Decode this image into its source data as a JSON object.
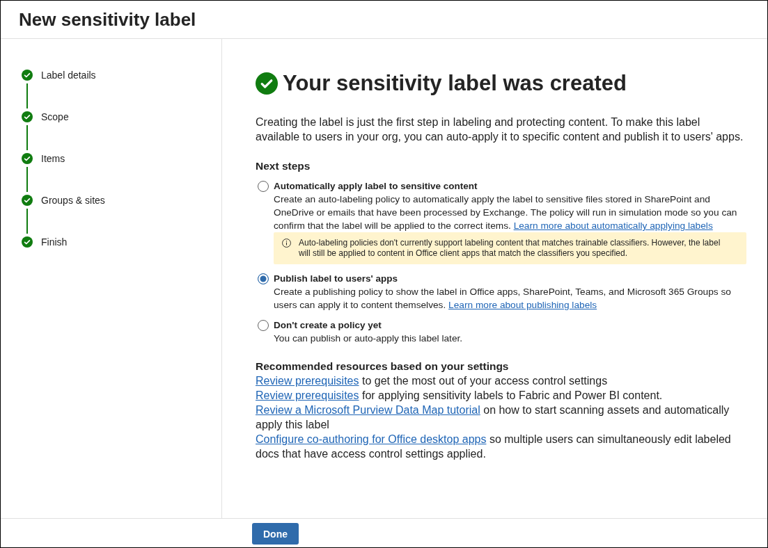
{
  "window": {
    "title": "New sensitivity label"
  },
  "steps": [
    {
      "label": "Label details",
      "completed": true
    },
    {
      "label": "Scope",
      "completed": true
    },
    {
      "label": "Items",
      "completed": true
    },
    {
      "label": "Groups & sites",
      "completed": true
    },
    {
      "label": "Finish",
      "completed": true
    }
  ],
  "confirmation": {
    "heading": "Your sensitivity label was created",
    "description": "Creating the label is just the first step in labeling and protecting content. To make this label available to users in your org, you can auto-apply it to specific content and publish it to users' apps."
  },
  "next_steps": {
    "heading": "Next steps",
    "options": [
      {
        "title": "Automatically apply label to sensitive content",
        "description": "Create an auto-labeling policy to automatically apply the label to sensitive files stored in SharePoint and OneDrive or emails that have been processed by Exchange. The policy will run in simulation mode so you can confirm that the label will be applied to the correct items.",
        "link": "Learn more about automatically applying labels",
        "notice": "Auto-labeling policies don't currently support labeling content that matches trainable classifiers. However, the label will still be applied to content in Office client apps that match the classifiers you specified.",
        "selected": false
      },
      {
        "title": "Publish label to users' apps",
        "description": "Create a publishing policy to show the label in Office apps, SharePoint, Teams, and Microsoft 365 Groups so users can apply it to content themselves.",
        "link": "Learn more about publishing labels",
        "selected": true
      },
      {
        "title": "Don't create a policy yet",
        "description": "You can publish or auto-apply this label later.",
        "selected": false
      }
    ]
  },
  "resources": {
    "heading": "Recommended resources based on your settings",
    "items": [
      {
        "link": "Review prerequisites",
        "text": "to get the most out of your access control settings"
      },
      {
        "link": "Review prerequisites",
        "text": "for applying sensitivity labels to Fabric and Power BI content."
      },
      {
        "link": "Review a Microsoft Purview Data Map tutorial",
        "text": "on how to start scanning assets and automatically apply this label"
      },
      {
        "link": "Configure co-authoring for Office desktop apps",
        "text": "so multiple users can simultaneously edit labeled docs that have access control settings applied."
      }
    ]
  },
  "footer": {
    "buttons": [
      "Done"
    ]
  }
}
